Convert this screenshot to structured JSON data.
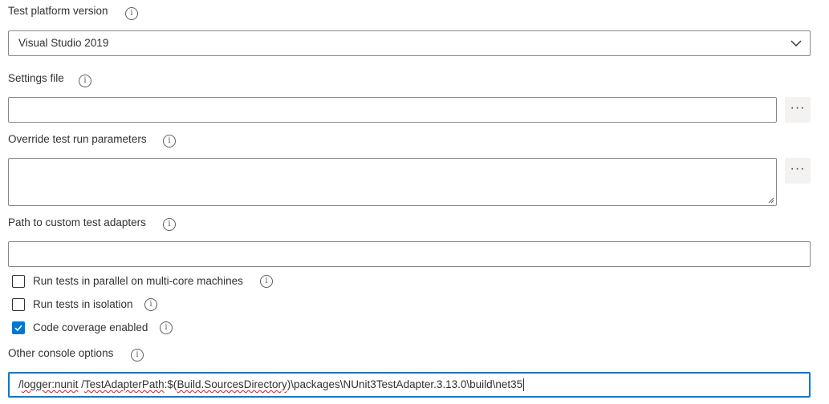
{
  "test_platform": {
    "label": "Test platform version",
    "value": "Visual Studio 2019"
  },
  "settings_file": {
    "label": "Settings file",
    "value": "",
    "browse_label": "···"
  },
  "override_params": {
    "label": "Override test run parameters",
    "value": "",
    "edit_label": "···"
  },
  "custom_adapters": {
    "label": "Path to custom test adapters",
    "value": ""
  },
  "options": [
    {
      "label": "Run tests in parallel on multi-core machines",
      "checked": false
    },
    {
      "label": "Run tests in isolation",
      "checked": false
    },
    {
      "label": "Code coverage enabled",
      "checked": true
    }
  ],
  "console_options": {
    "label": "Other console options",
    "value_parts": [
      "/",
      "logger:nunit",
      " /",
      "TestAdapterPath",
      ":$(",
      "Build.SourcesDirectory",
      ")\\packages\\NUnit3TestAdapter.3.13.0\\build\\net35"
    ]
  },
  "info_glyph": "i",
  "colors": {
    "accent": "#0078d4",
    "border": "#8a8886",
    "text": "#323130",
    "spellcheck": "#e81123"
  },
  "icons": {
    "dropdown": "chevron-down-icon",
    "info": "info-icon",
    "checkbox_checked": "check-icon"
  }
}
